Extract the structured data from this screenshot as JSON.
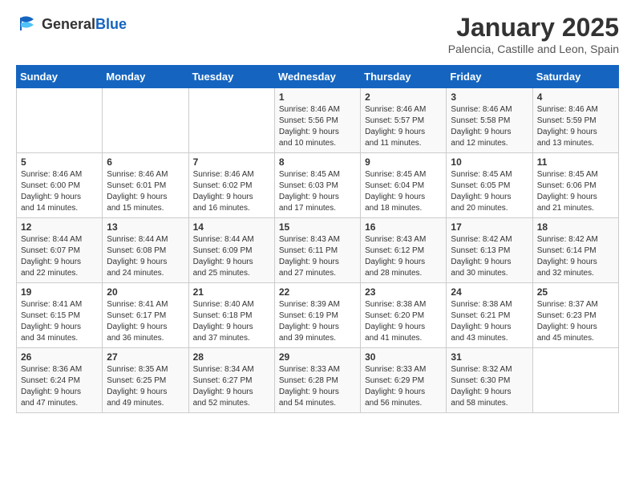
{
  "logo": {
    "general": "General",
    "blue": "Blue"
  },
  "header": {
    "title": "January 2025",
    "subtitle": "Palencia, Castille and Leon, Spain"
  },
  "weekdays": [
    "Sunday",
    "Monday",
    "Tuesday",
    "Wednesday",
    "Thursday",
    "Friday",
    "Saturday"
  ],
  "weeks": [
    [
      {
        "day": "",
        "info": ""
      },
      {
        "day": "",
        "info": ""
      },
      {
        "day": "",
        "info": ""
      },
      {
        "day": "1",
        "info": "Sunrise: 8:46 AM\nSunset: 5:56 PM\nDaylight: 9 hours\nand 10 minutes."
      },
      {
        "day": "2",
        "info": "Sunrise: 8:46 AM\nSunset: 5:57 PM\nDaylight: 9 hours\nand 11 minutes."
      },
      {
        "day": "3",
        "info": "Sunrise: 8:46 AM\nSunset: 5:58 PM\nDaylight: 9 hours\nand 12 minutes."
      },
      {
        "day": "4",
        "info": "Sunrise: 8:46 AM\nSunset: 5:59 PM\nDaylight: 9 hours\nand 13 minutes."
      }
    ],
    [
      {
        "day": "5",
        "info": "Sunrise: 8:46 AM\nSunset: 6:00 PM\nDaylight: 9 hours\nand 14 minutes."
      },
      {
        "day": "6",
        "info": "Sunrise: 8:46 AM\nSunset: 6:01 PM\nDaylight: 9 hours\nand 15 minutes."
      },
      {
        "day": "7",
        "info": "Sunrise: 8:46 AM\nSunset: 6:02 PM\nDaylight: 9 hours\nand 16 minutes."
      },
      {
        "day": "8",
        "info": "Sunrise: 8:45 AM\nSunset: 6:03 PM\nDaylight: 9 hours\nand 17 minutes."
      },
      {
        "day": "9",
        "info": "Sunrise: 8:45 AM\nSunset: 6:04 PM\nDaylight: 9 hours\nand 18 minutes."
      },
      {
        "day": "10",
        "info": "Sunrise: 8:45 AM\nSunset: 6:05 PM\nDaylight: 9 hours\nand 20 minutes."
      },
      {
        "day": "11",
        "info": "Sunrise: 8:45 AM\nSunset: 6:06 PM\nDaylight: 9 hours\nand 21 minutes."
      }
    ],
    [
      {
        "day": "12",
        "info": "Sunrise: 8:44 AM\nSunset: 6:07 PM\nDaylight: 9 hours\nand 22 minutes."
      },
      {
        "day": "13",
        "info": "Sunrise: 8:44 AM\nSunset: 6:08 PM\nDaylight: 9 hours\nand 24 minutes."
      },
      {
        "day": "14",
        "info": "Sunrise: 8:44 AM\nSunset: 6:09 PM\nDaylight: 9 hours\nand 25 minutes."
      },
      {
        "day": "15",
        "info": "Sunrise: 8:43 AM\nSunset: 6:11 PM\nDaylight: 9 hours\nand 27 minutes."
      },
      {
        "day": "16",
        "info": "Sunrise: 8:43 AM\nSunset: 6:12 PM\nDaylight: 9 hours\nand 28 minutes."
      },
      {
        "day": "17",
        "info": "Sunrise: 8:42 AM\nSunset: 6:13 PM\nDaylight: 9 hours\nand 30 minutes."
      },
      {
        "day": "18",
        "info": "Sunrise: 8:42 AM\nSunset: 6:14 PM\nDaylight: 9 hours\nand 32 minutes."
      }
    ],
    [
      {
        "day": "19",
        "info": "Sunrise: 8:41 AM\nSunset: 6:15 PM\nDaylight: 9 hours\nand 34 minutes."
      },
      {
        "day": "20",
        "info": "Sunrise: 8:41 AM\nSunset: 6:17 PM\nDaylight: 9 hours\nand 36 minutes."
      },
      {
        "day": "21",
        "info": "Sunrise: 8:40 AM\nSunset: 6:18 PM\nDaylight: 9 hours\nand 37 minutes."
      },
      {
        "day": "22",
        "info": "Sunrise: 8:39 AM\nSunset: 6:19 PM\nDaylight: 9 hours\nand 39 minutes."
      },
      {
        "day": "23",
        "info": "Sunrise: 8:38 AM\nSunset: 6:20 PM\nDaylight: 9 hours\nand 41 minutes."
      },
      {
        "day": "24",
        "info": "Sunrise: 8:38 AM\nSunset: 6:21 PM\nDaylight: 9 hours\nand 43 minutes."
      },
      {
        "day": "25",
        "info": "Sunrise: 8:37 AM\nSunset: 6:23 PM\nDaylight: 9 hours\nand 45 minutes."
      }
    ],
    [
      {
        "day": "26",
        "info": "Sunrise: 8:36 AM\nSunset: 6:24 PM\nDaylight: 9 hours\nand 47 minutes."
      },
      {
        "day": "27",
        "info": "Sunrise: 8:35 AM\nSunset: 6:25 PM\nDaylight: 9 hours\nand 49 minutes."
      },
      {
        "day": "28",
        "info": "Sunrise: 8:34 AM\nSunset: 6:27 PM\nDaylight: 9 hours\nand 52 minutes."
      },
      {
        "day": "29",
        "info": "Sunrise: 8:33 AM\nSunset: 6:28 PM\nDaylight: 9 hours\nand 54 minutes."
      },
      {
        "day": "30",
        "info": "Sunrise: 8:33 AM\nSunset: 6:29 PM\nDaylight: 9 hours\nand 56 minutes."
      },
      {
        "day": "31",
        "info": "Sunrise: 8:32 AM\nSunset: 6:30 PM\nDaylight: 9 hours\nand 58 minutes."
      },
      {
        "day": "",
        "info": ""
      }
    ]
  ]
}
